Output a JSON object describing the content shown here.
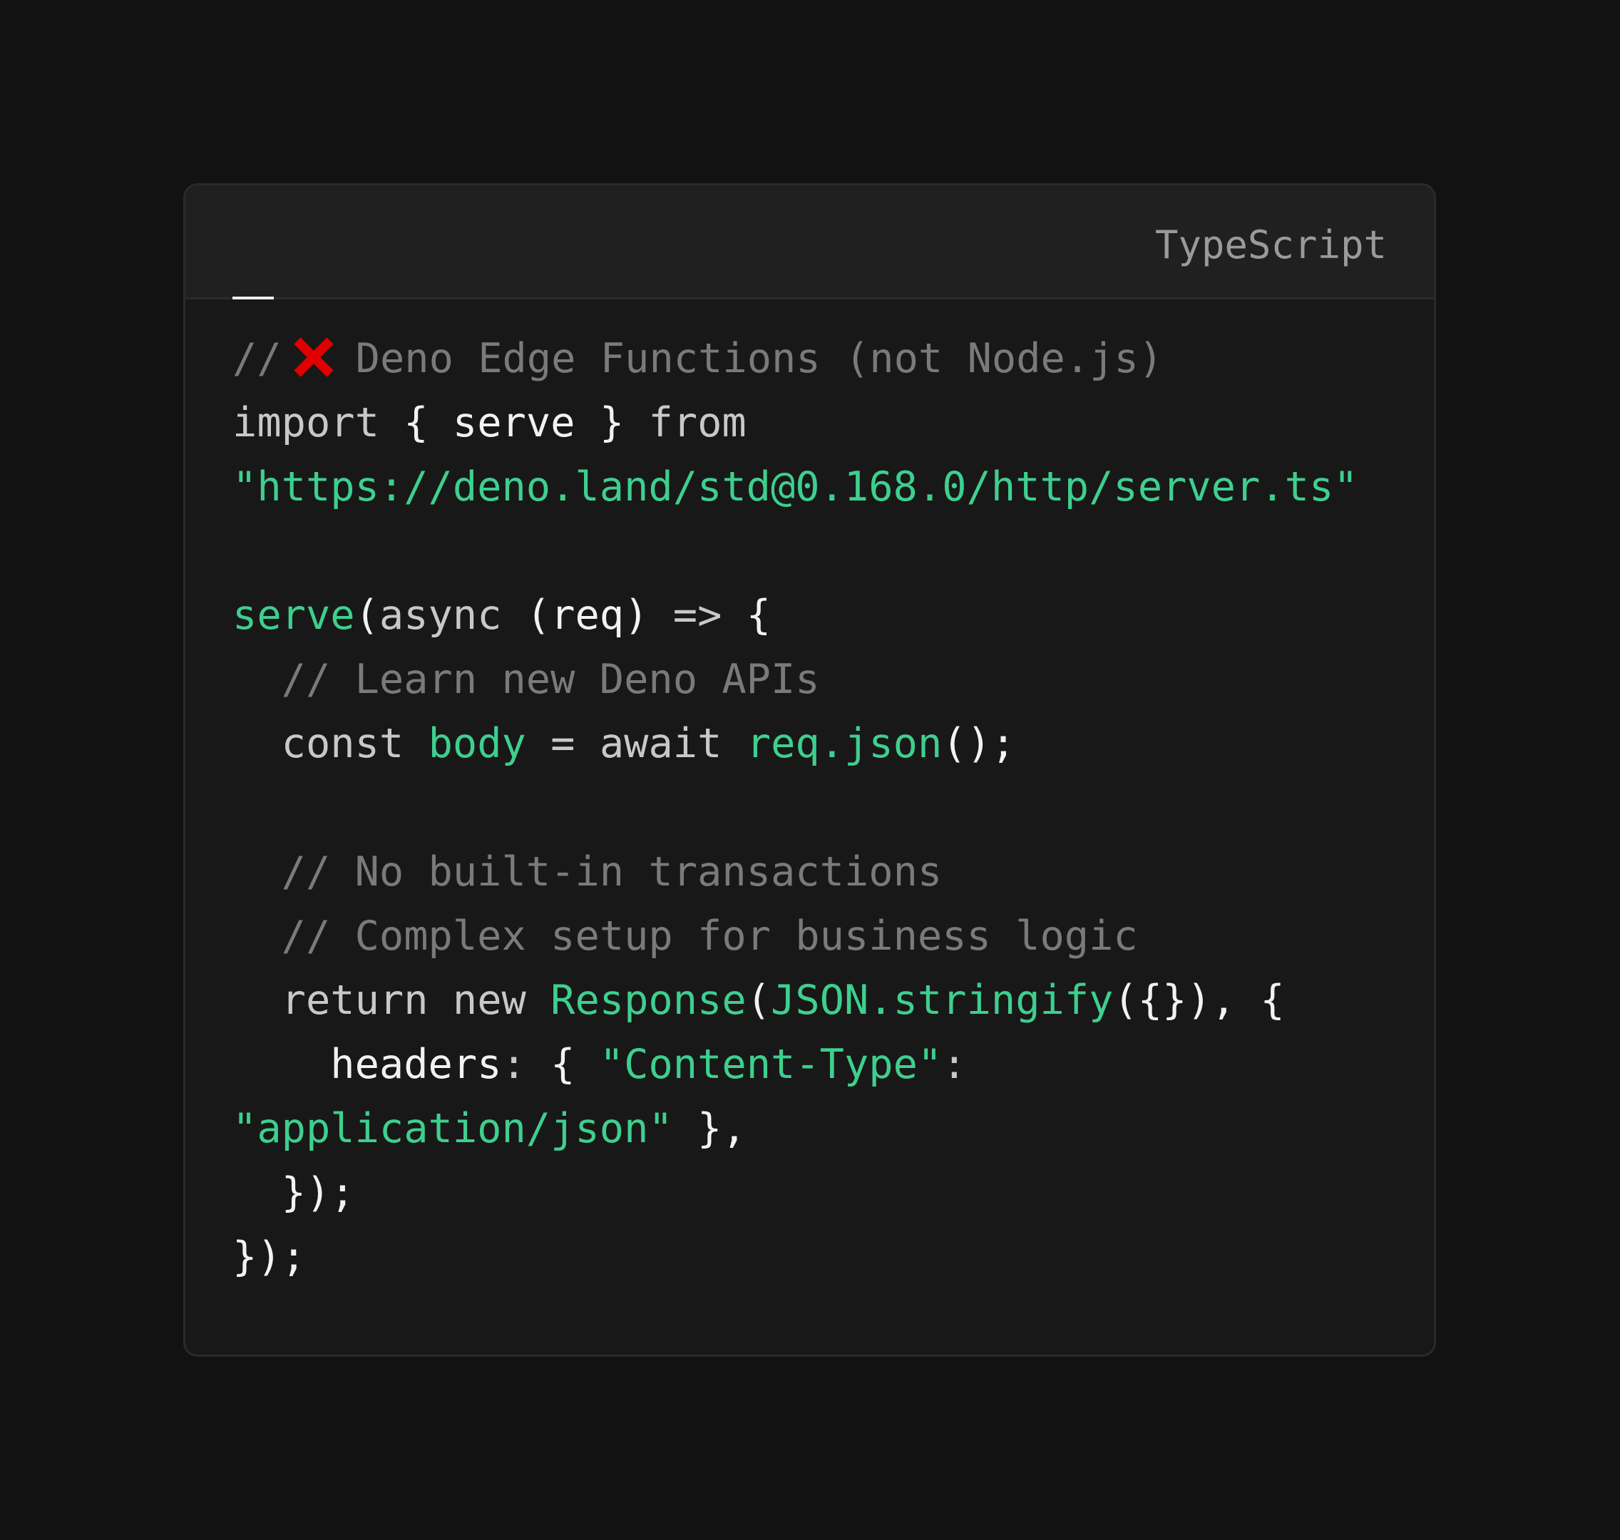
{
  "code_block": {
    "language": "TypeScript",
    "lines": {
      "l1": {
        "comment_prefix": "//",
        "icon": "cross-mark-icon",
        "icon_color": "#e00000",
        "comment_text": "Deno Edge Functions (not Node.js)"
      },
      "l2": {
        "kw_import": "import",
        "open_brace": "{",
        "ident_serve": "serve",
        "close_brace": "}",
        "kw_from": "from"
      },
      "l3": {
        "string_url": "\"https://deno.land/std@0.168.0/http/server.ts\""
      },
      "l5": {
        "fn_serve": "serve",
        "paren_open": "(",
        "kw_async": "async",
        "param": "(req)",
        "arrow": "=>",
        "brace": "{"
      },
      "l6": {
        "comment": "// Learn new Deno APIs"
      },
      "l7": {
        "kw_const": "const",
        "var_body": "body",
        "equals": "=",
        "kw_await": "await",
        "call_req_json": "req.json",
        "tail": "();"
      },
      "l9": {
        "comment": "// No built-in transactions"
      },
      "l10": {
        "comment": "// Complex setup for business logic"
      },
      "l11": {
        "kw_return": "return",
        "kw_new": "new",
        "cls_response": "Response",
        "paren_open": "(",
        "call_stringify": "JSON.stringify",
        "args": "({}),",
        "brace": "{"
      },
      "l12": {
        "prop_headers": "headers",
        "colon": ":",
        "brace": "{",
        "string_key": "\"Content-Type\"",
        "colon2": ":"
      },
      "l13": {
        "string_value": "\"application/json\"",
        "tail": "},"
      },
      "l14": {
        "text": "});"
      },
      "l15": {
        "text": "});"
      }
    }
  },
  "colors": {
    "background": "#121212",
    "card": "#181818",
    "header": "#202020",
    "accent_green": "#3ecf8e",
    "comment_gray": "#7a7a7a",
    "error_red": "#e00000"
  }
}
